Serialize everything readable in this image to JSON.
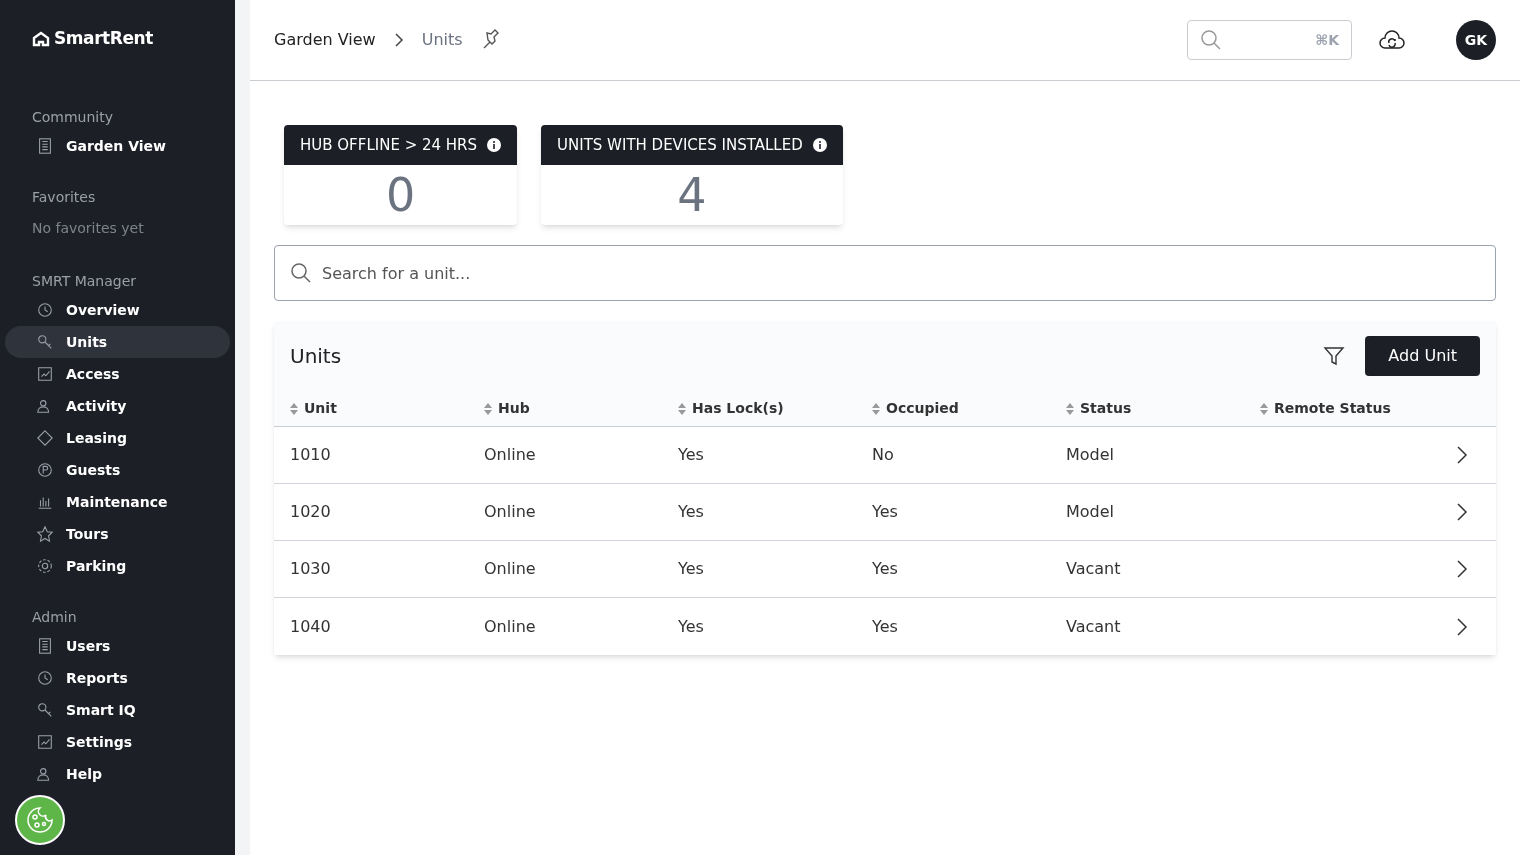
{
  "sidebar": {
    "logo": "SmartRent",
    "sections": [
      {
        "heading": "Community",
        "items": [
          {
            "label": "Garden View",
            "selected": false
          }
        ]
      },
      {
        "heading": "Favorites",
        "empty_text": "No favorites yet"
      },
      {
        "heading": "SMRT Manager",
        "items": [
          {
            "label": "Overview",
            "selected": false
          },
          {
            "label": "Units",
            "selected": true
          },
          {
            "label": "Access",
            "selected": false
          },
          {
            "label": "Activity",
            "selected": false
          },
          {
            "label": "Leasing",
            "selected": false
          },
          {
            "label": "Guests",
            "selected": false
          },
          {
            "label": "Maintenance",
            "selected": false
          },
          {
            "label": "Tours",
            "selected": false
          },
          {
            "label": "Parking",
            "selected": false
          }
        ]
      },
      {
        "heading": "Admin",
        "items": [
          {
            "label": "Users",
            "selected": false
          },
          {
            "label": "Reports",
            "selected": false
          },
          {
            "label": "Smart IQ",
            "selected": false
          },
          {
            "label": "Settings",
            "selected": false
          },
          {
            "label": "Help",
            "selected": false
          }
        ]
      }
    ]
  },
  "header": {
    "breadcrumbs": [
      "Garden View",
      "Units"
    ],
    "search_shortcut": "⌘K",
    "avatar": "GK"
  },
  "stats": [
    {
      "title": "HUB OFFLINE > 24 HRS",
      "value": "0"
    },
    {
      "title": "UNITS WITH DEVICES INSTALLED",
      "value": "4"
    }
  ],
  "search": {
    "placeholder": "Search for a unit..."
  },
  "table": {
    "title": "Units",
    "add_button": "Add Unit",
    "columns": [
      "Unit",
      "Hub",
      "Has Lock(s)",
      "Occupied",
      "Status",
      "Remote Status"
    ],
    "rows": [
      [
        "1010",
        "Online",
        "Yes",
        "No",
        "Model"
      ],
      [
        "1020",
        "Online",
        "Yes",
        "Yes",
        "Model"
      ],
      [
        "1030",
        "Online",
        "Yes",
        "Yes",
        "Vacant"
      ],
      [
        "1040",
        "Online",
        "Yes",
        "Yes",
        "Vacant"
      ]
    ]
  }
}
